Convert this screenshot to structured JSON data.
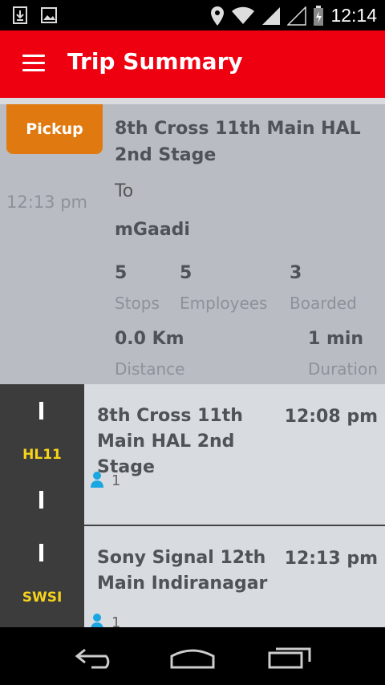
{
  "status_bar": {
    "time": "12:14"
  },
  "app_bar": {
    "title": "Trip Summary"
  },
  "summary": {
    "pickup_label": "Pickup",
    "time": "12:13 pm",
    "from": "8th Cross 11th Main HAL 2nd Stage",
    "to_label": "To",
    "destination": "mGaadi",
    "stops_value": "5",
    "stops_label": "Stops",
    "employees_value": "5",
    "employees_label": "Employees",
    "boarded_value": "3",
    "boarded_label": "Boarded",
    "distance_value": "0.0 Km",
    "distance_label": "Distance",
    "duration_value": "1 min",
    "duration_label": "Duration"
  },
  "stops": [
    {
      "code": "HL11",
      "name": "8th Cross 11th Main HAL 2nd Stage",
      "time": "12:08 pm",
      "count": "1"
    },
    {
      "code": "SWSI",
      "name": "Sony Signal  12th Main Indiranagar",
      "time": "12:13 pm",
      "count": "1"
    }
  ]
}
